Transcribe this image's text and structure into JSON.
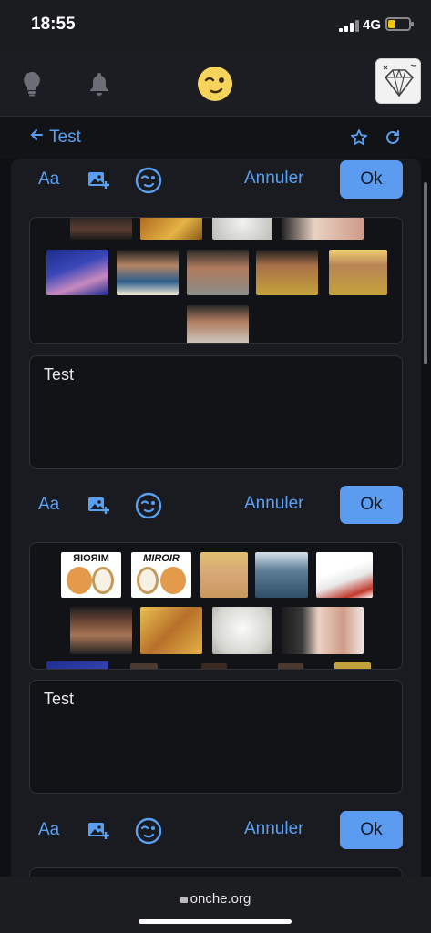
{
  "status_bar": {
    "time": "18:55",
    "network": "4G"
  },
  "header": {
    "lightbulb_icon": "lightbulb-icon",
    "bell_icon": "bell-icon",
    "logo_icon": "smiley-wink-icon",
    "avatar_icon": "diamond-avatar"
  },
  "topic": {
    "back_label": "Test",
    "star_icon": "star-icon",
    "refresh_icon": "refresh-icon"
  },
  "composers": [
    {
      "font_label": "Aa",
      "cancel_label": "Annuler",
      "ok_label": "Ok",
      "message": "Test"
    },
    {
      "font_label": "Aa",
      "cancel_label": "Annuler",
      "ok_label": "Ok",
      "message": "Test"
    },
    {
      "font_label": "Aa",
      "cancel_label": "Annuler",
      "ok_label": "Ok"
    }
  ],
  "stickers_top": [
    "pink-panther",
    "popcorn-man",
    "laughing-man",
    "crying-man",
    "crowned-man",
    "pointing-man"
  ],
  "stickers_mid": [
    "miroir-cat",
    "miroir-cat-2",
    "blond-man",
    "fisherman",
    "goofy",
    "blurred-face",
    "yelling-dwarf",
    "white-cat",
    "sleeping-man"
  ],
  "miroir_text": {
    "mirrored": "MIROIR",
    "normal": "MIROIR"
  },
  "url_bar": {
    "url": "onche.org"
  },
  "colors": {
    "accent": "#5a9ff2",
    "ok_button": "#5b9cf0",
    "background": "#0f1014",
    "card": "#1a1b20"
  }
}
